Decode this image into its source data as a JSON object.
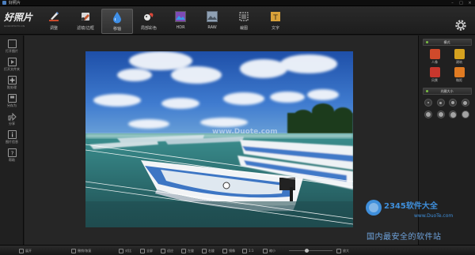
{
  "window": {
    "title": "好照片"
  },
  "logo": {
    "brand": "好照片",
    "tagline": "GOODPHOTO.CN"
  },
  "tools": [
    {
      "id": "adjust",
      "label": "调整",
      "icon": "pen-icon"
    },
    {
      "id": "filter",
      "label": "滤镜/边框",
      "icon": "brush-icon"
    },
    {
      "id": "tiltshift",
      "label": "移轴",
      "icon": "water-drop-icon",
      "active": true
    },
    {
      "id": "colorsplash",
      "label": "局部彩色",
      "icon": "squirrel-icon"
    },
    {
      "id": "hdr",
      "label": "HDR",
      "icon": "hdr-icon"
    },
    {
      "id": "raw",
      "label": "RAW",
      "icon": "raw-icon"
    },
    {
      "id": "crop",
      "label": "裁图",
      "icon": "crop-icon"
    },
    {
      "id": "text",
      "label": "文字",
      "icon": "text-icon"
    }
  ],
  "sidebar": {
    "items": [
      {
        "label": "打开图片",
        "icon": "open-file-icon"
      },
      {
        "label": "打开文件夹",
        "icon": "folder-icon"
      },
      {
        "label": "批处理",
        "icon": "batch-icon"
      },
      {
        "label": "另存为",
        "icon": "save-as-icon"
      },
      {
        "label": "分享",
        "icon": "share-icon"
      },
      {
        "label": "图片信息",
        "icon": "info-icon"
      },
      {
        "label": "帮助",
        "icon": "help-icon"
      }
    ]
  },
  "right_panel": {
    "mode_header": "模式",
    "modes": [
      {
        "label": "人像",
        "icon": "portrait-icon",
        "color": "#d04a2b"
      },
      {
        "label": "建筑",
        "icon": "building-icon",
        "color": "#d6a21f"
      },
      {
        "label": "风景",
        "icon": "landscape-icon",
        "color": "#c8372d"
      },
      {
        "label": "微距",
        "icon": "macro-icon",
        "color": "#e07b22"
      }
    ],
    "size_header": "光圈大小"
  },
  "bottombar": {
    "items": [
      {
        "label": "展开",
        "icon": "expand-icon"
      },
      {
        "label": "撤销/恢复",
        "icon": "undo-icon"
      },
      {
        "label": "对比",
        "icon": "compare-icon"
      },
      {
        "label": "全屏",
        "icon": "fullscreen-icon"
      },
      {
        "label": "适应",
        "icon": "fit-icon"
      },
      {
        "label": "左旋",
        "icon": "rotate-left-icon"
      },
      {
        "label": "右旋",
        "icon": "rotate-right-icon"
      },
      {
        "label": "镜像",
        "icon": "mirror-icon"
      },
      {
        "label": "1:1",
        "icon": "actual-size-icon"
      },
      {
        "label": "缩小",
        "icon": "zoom-out-icon"
      },
      {
        "label": "放大",
        "icon": "zoom-in-icon"
      }
    ]
  },
  "watermark": {
    "site": "2345软件大全",
    "url": "www.DuoTe.com",
    "slogan": "国内最安全的软件站"
  },
  "photo": {
    "overlay_text": "www.Duote.com"
  }
}
